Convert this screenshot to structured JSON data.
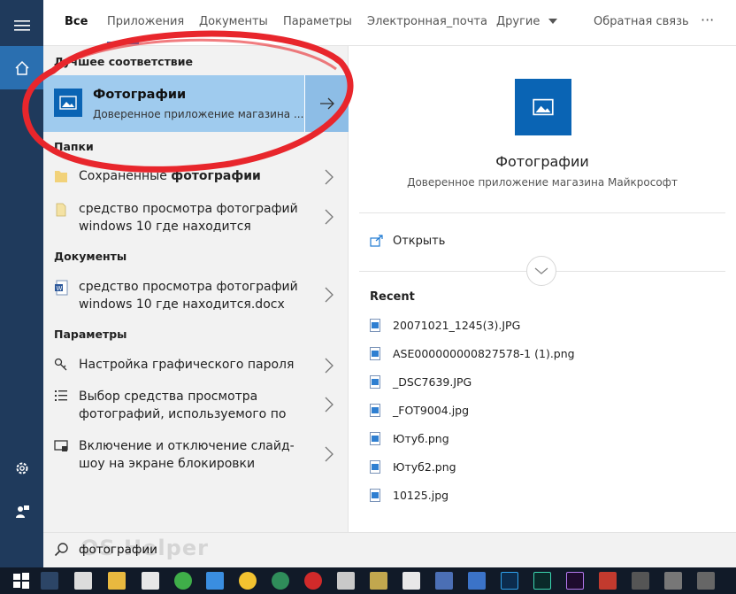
{
  "tabs": [
    "Все",
    "Приложения",
    "Документы",
    "Параметры",
    "Электронная_почта",
    "Другие"
  ],
  "feedback": "Обратная связь",
  "more": "···",
  "results": {
    "best_header": "Лучшее соответствие",
    "best": {
      "title": "Фотографии",
      "subtitle": "Доверенное приложение магазина ..."
    },
    "folders_header": "Папки",
    "folder1_prefix": "Сохраненные ",
    "folder1_bold": "фотографии",
    "folder2": "средство просмотра фотографий windows 10 где находится",
    "docs_header": "Документы",
    "doc1": "средство просмотра фотографий windows 10 где находится.docx",
    "settings_header": "Параметры",
    "set1": "Настройка графического пароля",
    "set2": "Выбор средства просмотра фотографий, используемого по",
    "set3": "Включение и отключение слайд-шоу на экране блокировки"
  },
  "detail": {
    "title": "Фотографии",
    "subtitle": "Доверенное приложение магазина Майкрософт",
    "open": "Открыть",
    "recent_header": "Recent",
    "files": [
      "20071021_1245(3).JPG",
      "ASE000000000827578-1 (1).png",
      "_DSC7639.JPG",
      "_FOT9004.jpg",
      "Ютуб.png",
      "Ютуб2.png",
      "10125.jpg"
    ]
  },
  "search": {
    "query": "фотографии",
    "watermark": "OS Helper"
  },
  "colors": {
    "accent": "#0a64b4",
    "highlight": "#9fcbee",
    "rail": "#1f3a5c",
    "annotation": "#e8262c"
  }
}
